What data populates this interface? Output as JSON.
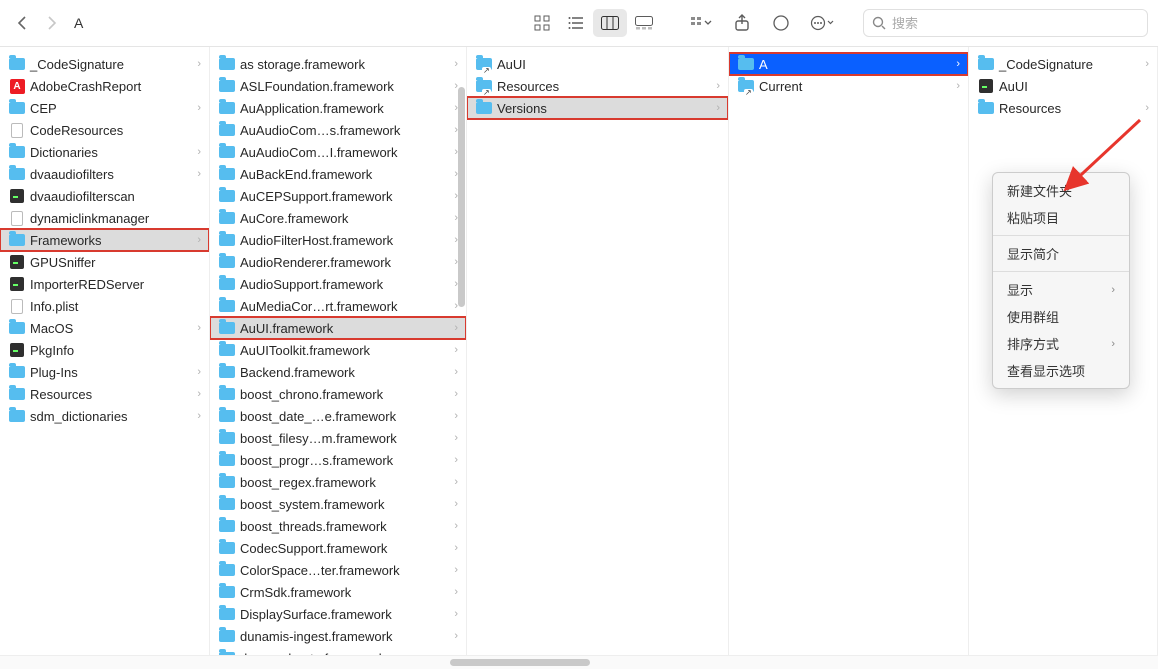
{
  "toolbar": {
    "breadcrumb": "A",
    "search_placeholder": "搜索"
  },
  "columns": {
    "c1": [
      {
        "name": "_CodeSignature",
        "icon": "folder",
        "hasArrow": true
      },
      {
        "name": "AdobeCrashReport",
        "icon": "adobe"
      },
      {
        "name": "CEP",
        "icon": "folder",
        "hasArrow": true
      },
      {
        "name": "CodeResources",
        "icon": "file"
      },
      {
        "name": "Dictionaries",
        "icon": "folder",
        "hasArrow": true
      },
      {
        "name": "dvaaudiofilters",
        "icon": "folder",
        "hasArrow": true
      },
      {
        "name": "dvaaudiofilterscan",
        "icon": "exec"
      },
      {
        "name": "dynamiclinkmanager",
        "icon": "file"
      },
      {
        "name": "Frameworks",
        "icon": "folder",
        "hasArrow": true,
        "selected": "gray",
        "boxed": true
      },
      {
        "name": "GPUSniffer",
        "icon": "exec"
      },
      {
        "name": "ImporterREDServer",
        "icon": "exec"
      },
      {
        "name": "Info.plist",
        "icon": "file"
      },
      {
        "name": "MacOS",
        "icon": "folder",
        "hasArrow": true
      },
      {
        "name": "PkgInfo",
        "icon": "exec"
      },
      {
        "name": "Plug-Ins",
        "icon": "folder",
        "hasArrow": true
      },
      {
        "name": "Resources",
        "icon": "folder",
        "hasArrow": true
      },
      {
        "name": "sdm_dictionaries",
        "icon": "folder",
        "hasArrow": true
      }
    ],
    "c2": [
      {
        "name": "as  storage.framework",
        "icon": "folder",
        "hasArrow": true
      },
      {
        "name": "ASLFoundation.framework",
        "icon": "folder",
        "hasArrow": true
      },
      {
        "name": "AuApplication.framework",
        "icon": "folder",
        "hasArrow": true
      },
      {
        "name": "AuAudioCom…s.framework",
        "icon": "folder",
        "hasArrow": true
      },
      {
        "name": "AuAudioCom…I.framework",
        "icon": "folder",
        "hasArrow": true
      },
      {
        "name": "AuBackEnd.framework",
        "icon": "folder",
        "hasArrow": true
      },
      {
        "name": "AuCEPSupport.framework",
        "icon": "folder",
        "hasArrow": true
      },
      {
        "name": "AuCore.framework",
        "icon": "folder",
        "hasArrow": true
      },
      {
        "name": "AudioFilterHost.framework",
        "icon": "folder",
        "hasArrow": true
      },
      {
        "name": "AudioRenderer.framework",
        "icon": "folder",
        "hasArrow": true
      },
      {
        "name": "AudioSupport.framework",
        "icon": "folder",
        "hasArrow": true
      },
      {
        "name": "AuMediaCor…rt.framework",
        "icon": "folder",
        "hasArrow": true
      },
      {
        "name": "AuUI.framework",
        "icon": "folder",
        "hasArrow": true,
        "selected": "gray",
        "boxed": true
      },
      {
        "name": "AuUIToolkit.framework",
        "icon": "folder",
        "hasArrow": true
      },
      {
        "name": "Backend.framework",
        "icon": "folder",
        "hasArrow": true
      },
      {
        "name": "boost_chrono.framework",
        "icon": "folder",
        "hasArrow": true
      },
      {
        "name": "boost_date_…e.framework",
        "icon": "folder",
        "hasArrow": true
      },
      {
        "name": "boost_filesy…m.framework",
        "icon": "folder",
        "hasArrow": true
      },
      {
        "name": "boost_progr…s.framework",
        "icon": "folder",
        "hasArrow": true
      },
      {
        "name": "boost_regex.framework",
        "icon": "folder",
        "hasArrow": true
      },
      {
        "name": "boost_system.framework",
        "icon": "folder",
        "hasArrow": true
      },
      {
        "name": "boost_threads.framework",
        "icon": "folder",
        "hasArrow": true
      },
      {
        "name": "CodecSupport.framework",
        "icon": "folder",
        "hasArrow": true
      },
      {
        "name": "ColorSpace…ter.framework",
        "icon": "folder",
        "hasArrow": true
      },
      {
        "name": "CrmSdk.framework",
        "icon": "folder",
        "hasArrow": true
      },
      {
        "name": "DisplaySurface.framework",
        "icon": "folder",
        "hasArrow": true
      },
      {
        "name": "dunamis-ingest.framework",
        "icon": "folder",
        "hasArrow": true
      },
      {
        "name": "dvaaccelerate.framework",
        "icon": "folder",
        "hasArrow": true
      }
    ],
    "c3": [
      {
        "name": "AuUI",
        "icon": "alias"
      },
      {
        "name": "Resources",
        "icon": "alias",
        "hasArrow": true
      },
      {
        "name": "Versions",
        "icon": "folder",
        "hasArrow": true,
        "selected": "gray",
        "boxed": true
      }
    ],
    "c4": [
      {
        "name": "A",
        "icon": "folder",
        "hasArrow": true,
        "selected": "blue",
        "boxed": true
      },
      {
        "name": "Current",
        "icon": "alias",
        "hasArrow": true
      }
    ],
    "c5": [
      {
        "name": "_CodeSignature",
        "icon": "folder",
        "hasArrow": true
      },
      {
        "name": "AuUI",
        "icon": "exec"
      },
      {
        "name": "Resources",
        "icon": "folder",
        "hasArrow": true
      }
    ]
  },
  "context_menu": {
    "items": [
      {
        "label": "新建文件夹"
      },
      {
        "label": "粘贴项目"
      },
      {
        "sep": true
      },
      {
        "label": "显示简介"
      },
      {
        "sep": true
      },
      {
        "label": "显示",
        "sub": true
      },
      {
        "label": "使用群组"
      },
      {
        "label": "排序方式",
        "sub": true
      },
      {
        "label": "查看显示选项"
      }
    ]
  }
}
